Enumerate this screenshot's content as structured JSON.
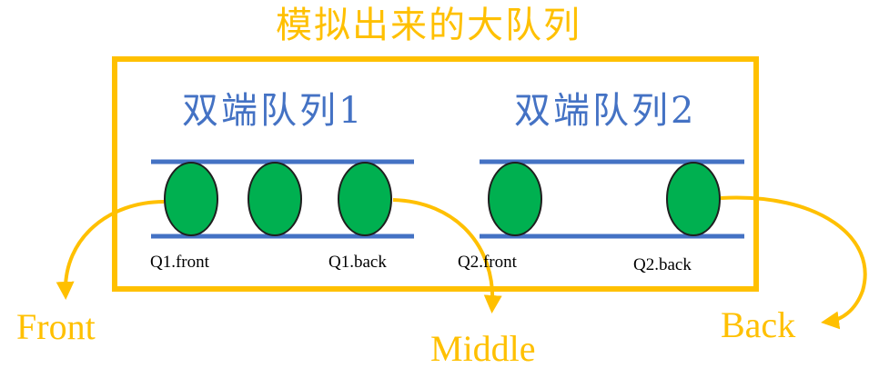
{
  "title": "模拟出来的大队列",
  "colors": {
    "frame": "#ffc000",
    "rail": "#4472c4",
    "node_fill": "#00b050",
    "node_stroke": "#1f1f1f",
    "arrow": "#ffc000"
  },
  "deques": [
    {
      "title": "双端队列1",
      "front_label": "Q1.front",
      "back_label": "Q1.back",
      "node_count": 3
    },
    {
      "title": "双端队列2",
      "front_label": "Q2.front",
      "back_label": "Q2.back",
      "node_count": 2
    }
  ],
  "end_labels": {
    "front": "Front",
    "middle": "Middle",
    "back": "Back"
  }
}
